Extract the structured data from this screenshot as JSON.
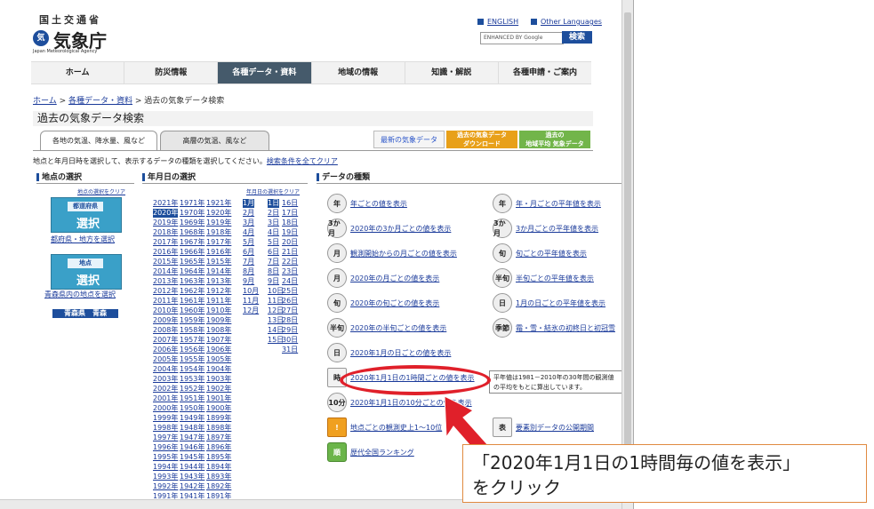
{
  "header": {
    "logo_top": "国土交通省",
    "logo_emblem": "気",
    "logo_main": "気象庁",
    "logo_sub": "Japan Meteorological Agency",
    "english": "ENGLISH",
    "other_languages": "Other Languages",
    "search_placeholder": "ENHANCED BY Google",
    "search_button": "検索"
  },
  "nav": [
    "ホーム",
    "防災情報",
    "各種データ・資料",
    "地域の情報",
    "知識・解説",
    "各種申請・ご案内"
  ],
  "nav_active_index": 2,
  "breadcrumb": {
    "home": "ホーム",
    "sep1": " > ",
    "data": "各種データ・資料",
    "sep2": " > ",
    "current": "過去の気象データ検索"
  },
  "page_title": "過去の気象データ検索",
  "tabs": {
    "tab1": "各地の気温、降水量、風など",
    "tab2": "高層の気温、風など"
  },
  "banners": {
    "b1": "最新の気象データ",
    "b2a": "過去の気象データ",
    "b2b": "ダウンロード",
    "b3a": "過去の",
    "b3b": "地域平均 気象データ"
  },
  "instruction": "地点と年月日時を選択して、表示するデータの種類を選択してください。",
  "instruction_link": "検索条件を全てクリア",
  "sections": {
    "station": "地点の選択",
    "date": "年月日の選択",
    "datatype": "データの種類"
  },
  "station": {
    "clear": "地点の選択をクリア",
    "pref_label": "都道府県",
    "select": "選択",
    "pref_link": "都府県・地方を選択",
    "point_label": "地点",
    "point_link": "青森県内の地点を選択",
    "selected": "青森県　青森"
  },
  "date": {
    "clear": "年月日の選択をクリア",
    "years": [
      [
        "2021年",
        "1971年",
        "1921年"
      ],
      [
        "2020年",
        "1970年",
        "1920年"
      ],
      [
        "2019年",
        "1969年",
        "1919年"
      ],
      [
        "2018年",
        "1968年",
        "1918年"
      ],
      [
        "2017年",
        "1967年",
        "1917年"
      ],
      [
        "2016年",
        "1966年",
        "1916年"
      ],
      [
        "2015年",
        "1965年",
        "1915年"
      ],
      [
        "2014年",
        "1964年",
        "1914年"
      ],
      [
        "2013年",
        "1963年",
        "1913年"
      ],
      [
        "2012年",
        "1962年",
        "1912年"
      ],
      [
        "2011年",
        "1961年",
        "1911年"
      ],
      [
        "2010年",
        "1960年",
        "1910年"
      ],
      [
        "2009年",
        "1959年",
        "1909年"
      ],
      [
        "2008年",
        "1958年",
        "1908年"
      ],
      [
        "2007年",
        "1957年",
        "1907年"
      ],
      [
        "2006年",
        "1956年",
        "1906年"
      ],
      [
        "2005年",
        "1955年",
        "1905年"
      ],
      [
        "2004年",
        "1954年",
        "1904年"
      ],
      [
        "2003年",
        "1953年",
        "1903年"
      ],
      [
        "2002年",
        "1952年",
        "1902年"
      ],
      [
        "2001年",
        "1951年",
        "1901年"
      ],
      [
        "2000年",
        "1950年",
        "1900年"
      ],
      [
        "1999年",
        "1949年",
        "1899年"
      ],
      [
        "1998年",
        "1948年",
        "1898年"
      ],
      [
        "1997年",
        "1947年",
        "1897年"
      ],
      [
        "1996年",
        "1946年",
        "1896年"
      ],
      [
        "1995年",
        "1945年",
        "1895年"
      ],
      [
        "1994年",
        "1944年",
        "1894年"
      ],
      [
        "1993年",
        "1943年",
        "1893年"
      ],
      [
        "1992年",
        "1942年",
        "1892年"
      ],
      [
        "1991年",
        "1941年",
        "1891年"
      ]
    ],
    "months": [
      "1月",
      "2月",
      "3月",
      "4月",
      "5月",
      "6月",
      "7月",
      "8月",
      "9月",
      "10月",
      "11月",
      "12月"
    ],
    "days": [
      [
        "1日",
        "16日"
      ],
      [
        "2日",
        "17日"
      ],
      [
        "3日",
        "18日"
      ],
      [
        "4日",
        "19日"
      ],
      [
        "5日",
        "20日"
      ],
      [
        "6日",
        "21日"
      ],
      [
        "7日",
        "22日"
      ],
      [
        "8日",
        "23日"
      ],
      [
        "9日",
        "24日"
      ],
      [
        "10日",
        "25日"
      ],
      [
        "11日",
        "26日"
      ],
      [
        "12日",
        "27日"
      ],
      [
        "13日",
        "28日"
      ],
      [
        "14日",
        "29日"
      ],
      [
        "15日",
        "30日"
      ],
      [
        "",
        "31日"
      ]
    ],
    "selected_year": "2020年",
    "selected_month": "1月",
    "selected_day": "1日"
  },
  "datatypes_left": [
    {
      "icon": "年",
      "label": "年ごとの値を表示"
    },
    {
      "icon": "3か月",
      "label": "2020年の3か月ごとの値を表示"
    },
    {
      "icon": "月",
      "label": "観測開始からの月ごとの値を表示"
    },
    {
      "icon": "月",
      "label": "2020年の月ごとの値を表示"
    },
    {
      "icon": "旬",
      "label": "2020年の旬ごとの値を表示"
    },
    {
      "icon": "半旬",
      "label": "2020年の半旬ごとの値を表示"
    },
    {
      "icon": "日",
      "label": "2020年1月の日ごとの値を表示"
    },
    {
      "icon": "時",
      "label": "2020年1月1日の1時間ごとの値を表示"
    },
    {
      "icon": "10分",
      "label": "2020年1月1日の10分ごとの値を表示"
    },
    {
      "icon": "!",
      "label": "地点ごとの観測史上1～10位"
    },
    {
      "icon": "順",
      "label": "歴代全国ランキング"
    }
  ],
  "datatypes_right": [
    {
      "icon": "年",
      "label": "年・月ごとの平年値を表示"
    },
    {
      "icon": "3か月",
      "label": "3か月ごとの平年値を表示"
    },
    {
      "icon": "旬",
      "label": "旬ごとの平年値を表示"
    },
    {
      "icon": "半旬",
      "label": "半旬ごとの平年値を表示"
    },
    {
      "icon": "日",
      "label": "1月の日ごとの平年値を表示"
    },
    {
      "icon": "季節",
      "label": "霜・雪・結氷の初終日と初冠雪"
    },
    {
      "icon": "表",
      "label": "要素別データの公開期間"
    }
  ],
  "tooltip": "平年値は1981－2010年の30年間の観測値の平均をもとに算出しています。",
  "callout_line1": "「2020年1月1日の1時間毎の値を表示」",
  "callout_line2": "をクリック",
  "colors": {
    "brand": "#1d4e9c",
    "highlight": "#e0202a",
    "callout_border": "#e08a40"
  }
}
